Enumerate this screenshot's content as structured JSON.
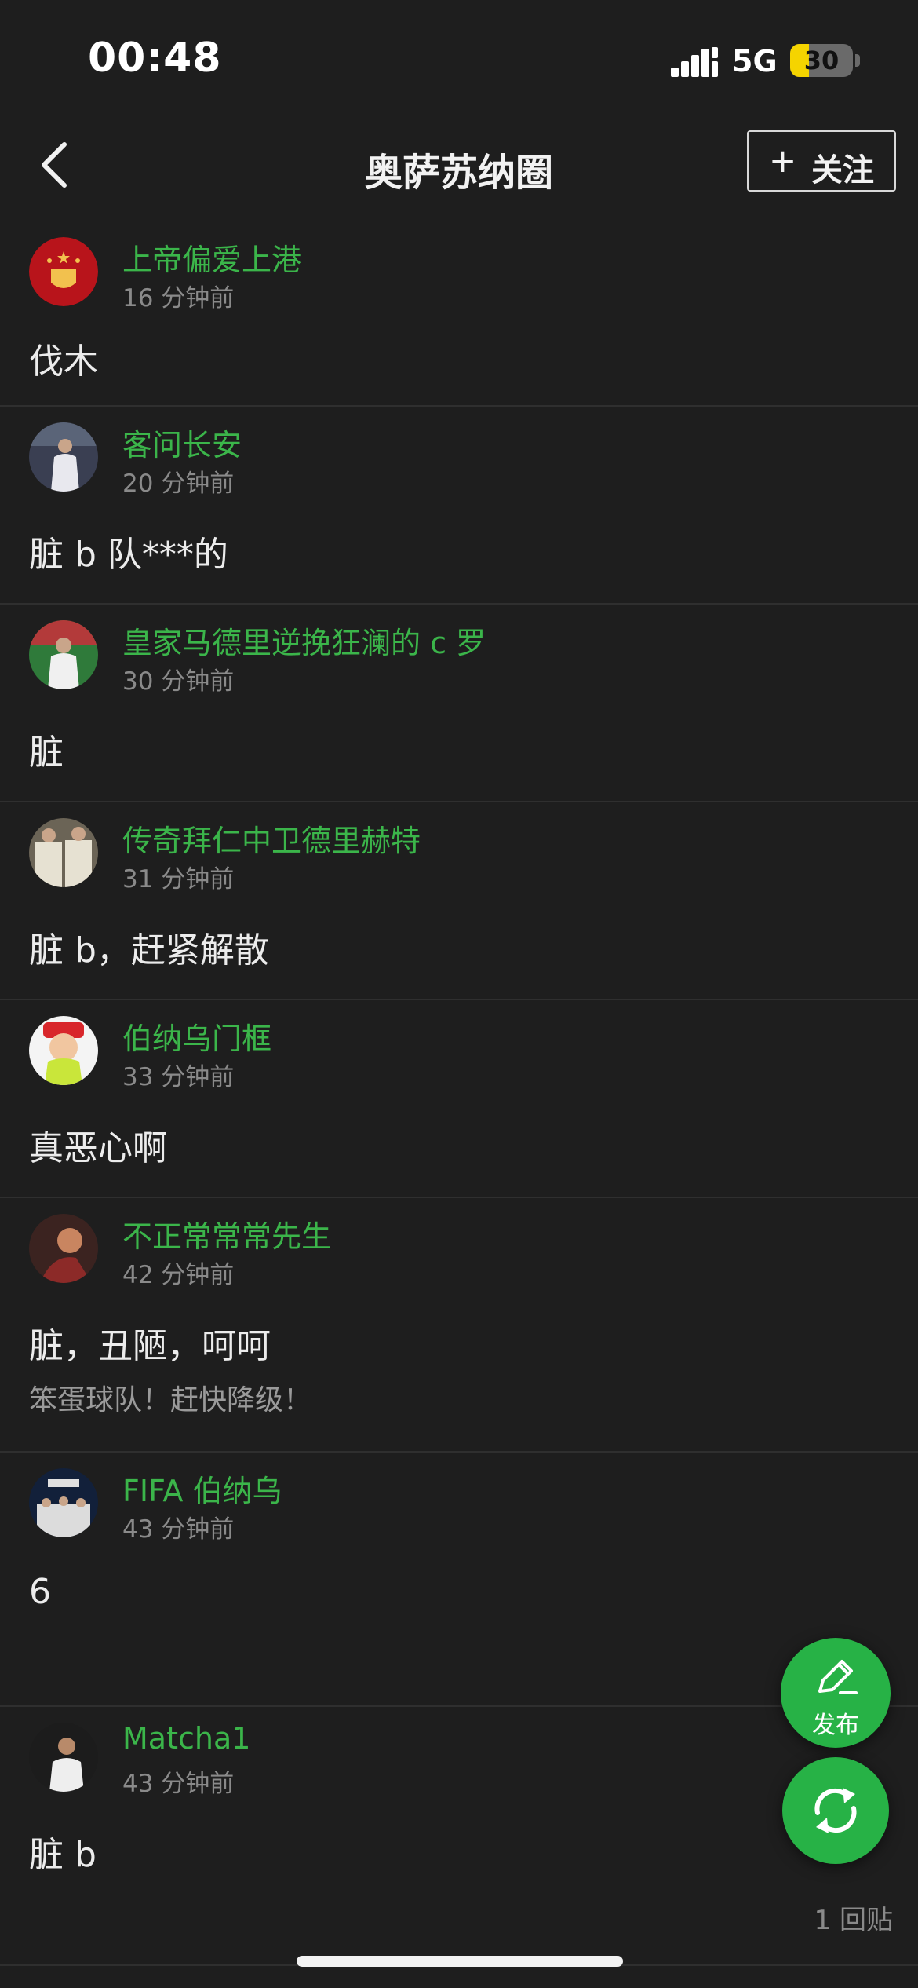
{
  "status_bar": {
    "time": "00:48",
    "network": "5G",
    "battery": "30",
    "battery_level": 0.3
  },
  "nav": {
    "title": "奥萨苏纳圈",
    "follow_plus": "+",
    "follow_label": "关注"
  },
  "posts": [
    {
      "author": "上帝偏爱上港",
      "time": "16 分钟前",
      "text": "伐木",
      "avatar_icon": "club-crest-icon"
    },
    {
      "author": "客问长安",
      "time": "20 分钟前",
      "text": "脏 b 队***的",
      "avatar_icon": "player-photo-icon"
    },
    {
      "author": "皇家马德里逆挽狂澜的 c 罗",
      "time": "30 分钟前",
      "text": "脏",
      "avatar_icon": "player-photo-icon"
    },
    {
      "author": "传奇拜仁中卫德里赫特",
      "time": "31 分钟前",
      "text": "脏 b，赶紧解散",
      "avatar_icon": "players-photo-icon"
    },
    {
      "author": "伯纳乌门框",
      "time": "33 分钟前",
      "text": "真恶心啊",
      "avatar_icon": "cartoon-child-icon"
    },
    {
      "author": "不正常常常先生",
      "time": "42 分钟前",
      "text": "脏，丑陋，呵呵",
      "subtext": "笨蛋球队！赶快降级！",
      "avatar_icon": "photo-icon"
    },
    {
      "author": "FIFA 伯纳乌",
      "time": "43 分钟前",
      "text": "6",
      "avatar_icon": "team-photo-icon"
    },
    {
      "author": "Matcha1",
      "time": "43 分钟前",
      "text": "脏 b",
      "replies": "1 回贴",
      "avatar_icon": "player-photo-icon"
    }
  ],
  "fab": {
    "post_label": "发布",
    "post_icon": "pencil-icon",
    "refresh_icon": "refresh-icon"
  },
  "colors": {
    "background": "#1e1e1e",
    "author_green": "#3bb54a",
    "fab_green": "#27b246",
    "divider": "#2f2f2f"
  }
}
